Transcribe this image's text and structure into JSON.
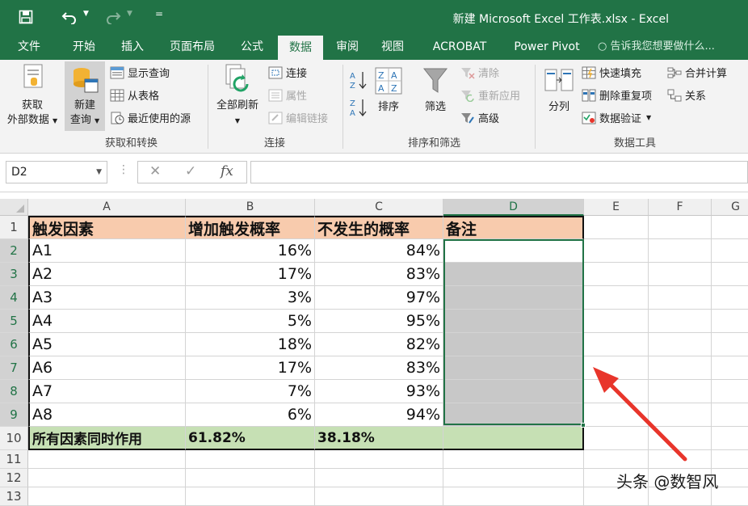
{
  "window": {
    "title": "新建 Microsoft Excel 工作表.xlsx - Excel",
    "qat_icons": [
      "save-icon",
      "undo-icon",
      "redo-icon",
      "customize-icon"
    ],
    "title_color": "#217346"
  },
  "ribbon_tabs": {
    "file": "文件",
    "home": "开始",
    "insert": "插入",
    "page_layout": "页面布局",
    "formulas": "公式",
    "data": "数据",
    "review": "审阅",
    "view": "视图",
    "acrobat": "ACROBAT",
    "power_pivot": "Power Pivot",
    "tell_me": "告诉我您想要做什么...",
    "active": "数据"
  },
  "ribbon": {
    "get_transform": {
      "get_external_line1": "获取",
      "get_external_line2": "外部数据",
      "new_query_line1": "新建",
      "new_query_line2": "查询",
      "show_queries": "显示查询",
      "from_table": "从表格",
      "recent_sources": "最近使用的源",
      "group_label": "获取和转换"
    },
    "connections": {
      "refresh_all": "全部刷新",
      "connections": "连接",
      "properties": "属性",
      "edit_links": "编辑链接",
      "group_label": "连接"
    },
    "sort_filter": {
      "sort": "排序",
      "filter": "筛选",
      "clear": "清除",
      "reapply": "重新应用",
      "advanced": "高级",
      "group_label": "排序和筛选"
    },
    "data_tools": {
      "text_to_columns": "分列",
      "flash_fill": "快速填充",
      "remove_duplicates": "删除重复项",
      "data_validation": "数据验证",
      "consolidate": "合并计算",
      "relationships": "关系",
      "group_label": "数据工具"
    }
  },
  "formula_bar": {
    "name_box": "D2",
    "cancel_icon": "✕",
    "enter_icon": "✓",
    "fx_label": "fx",
    "formula": ""
  },
  "sheet": {
    "columns": [
      "A",
      "B",
      "C",
      "D",
      "E",
      "F",
      "G"
    ],
    "row_numbers": [
      "1",
      "2",
      "3",
      "4",
      "5",
      "6",
      "7",
      "8",
      "9",
      "10",
      "11",
      "12",
      "13"
    ],
    "header_row": [
      "触发因素",
      "增加触发概率",
      "不发生的概率",
      "备注"
    ],
    "rows": [
      [
        "A1",
        "16%",
        "84%",
        ""
      ],
      [
        "A2",
        "17%",
        "83%",
        ""
      ],
      [
        "A3",
        "3%",
        "97%",
        ""
      ],
      [
        "A4",
        "5%",
        "95%",
        ""
      ],
      [
        "A5",
        "18%",
        "82%",
        ""
      ],
      [
        "A6",
        "17%",
        "83%",
        ""
      ],
      [
        "A7",
        "7%",
        "93%",
        ""
      ],
      [
        "A8",
        "6%",
        "94%",
        ""
      ]
    ],
    "footer_row": [
      "所有因素同时作用",
      "61.82%",
      "38.18%",
      ""
    ],
    "selected_range": "D2:D9",
    "colors": {
      "header_fill": "#f8cbad",
      "footer_fill": "#c6e0b4",
      "selection_fill": "#c8c8c8",
      "selection_border": "#217346"
    }
  },
  "annotation": {
    "arrow_color": "#e8352b"
  },
  "watermark": {
    "text": "头条 @数智风"
  }
}
